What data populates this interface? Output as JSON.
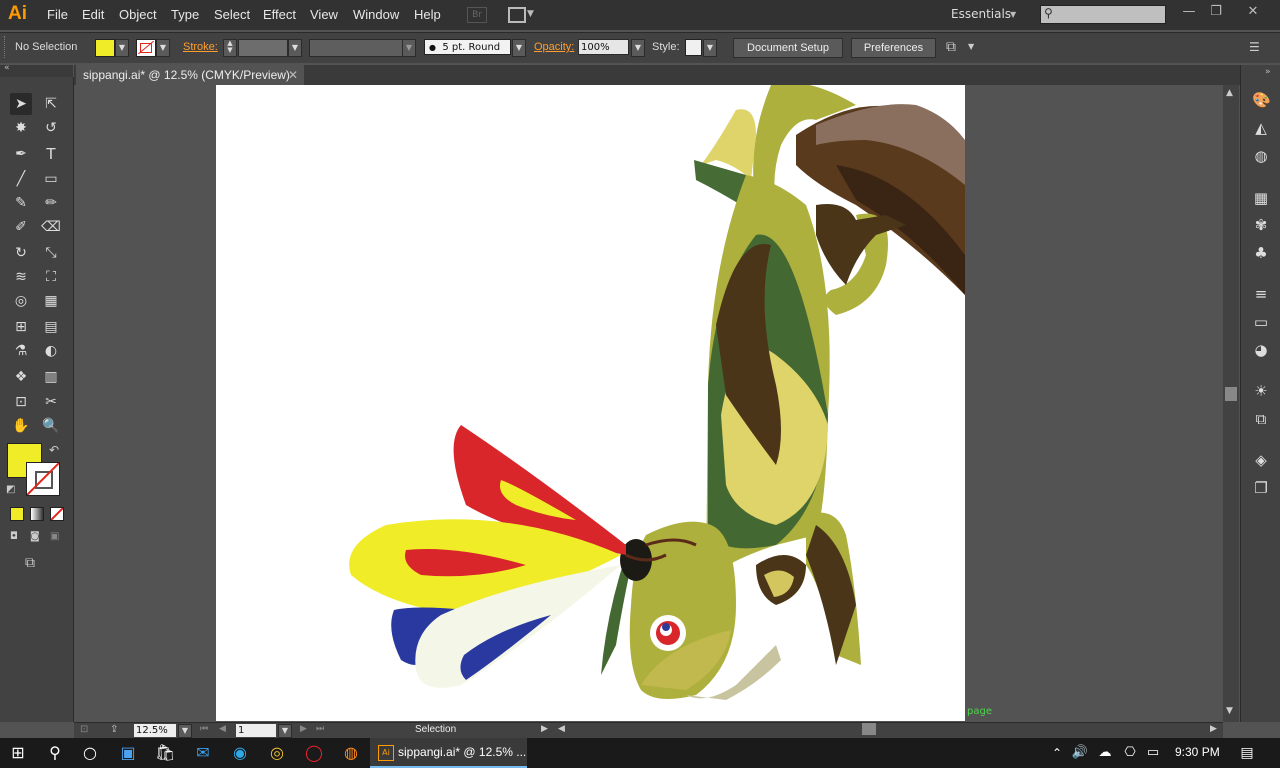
{
  "app": {
    "logo": "Ai"
  },
  "menubar": {
    "items": [
      "File",
      "Edit",
      "Object",
      "Type",
      "Select",
      "Effect",
      "View",
      "Window",
      "Help"
    ],
    "bridge_label": "Br",
    "workspace": "Essentials",
    "search_placeholder": ""
  },
  "controlbar": {
    "selection_status": "No Selection",
    "stroke_label": "Stroke:",
    "brush_label": "5 pt. Round",
    "opacity_label": "Opacity:",
    "opacity_value": "100%",
    "style_label": "Style:",
    "document_setup": "Document Setup",
    "preferences": "Preferences",
    "fill_color": "#f0ec27"
  },
  "document_tab": {
    "title": "sippangi.ai* @ 12.5% (CMYK/Preview)"
  },
  "statusbar": {
    "zoom": "12.5%",
    "artboard_number": "1",
    "tool_status": "Selection",
    "page_label": "page"
  },
  "taskbar": {
    "active_app": "sippangi.ai* @ 12.5% ...",
    "time": "9:30 PM"
  },
  "colors": {
    "accent": "#ff9d2e",
    "fill_swatch": "#f0ec27"
  }
}
